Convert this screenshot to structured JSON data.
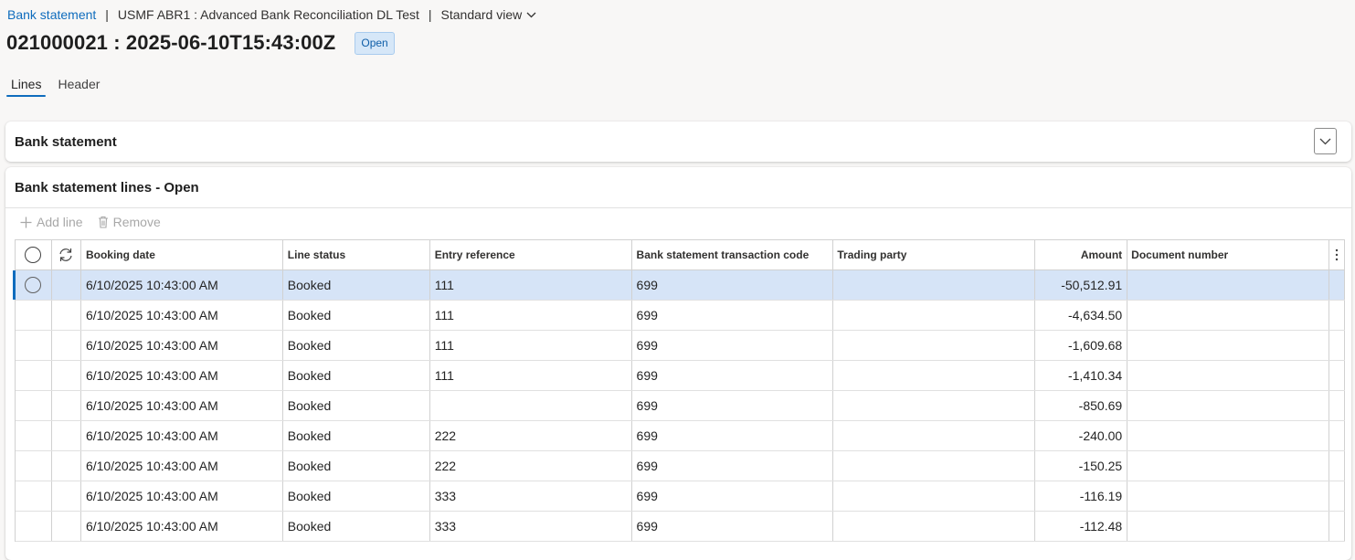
{
  "breadcrumb": {
    "link": "Bank statement",
    "company_context": "USMF ABR1 : Advanced Bank Reconciliation DL Test",
    "view": "Standard view"
  },
  "page": {
    "title": "021000021 : 2025-06-10T15:43:00Z",
    "status": "Open"
  },
  "tabs": [
    {
      "label": "Lines",
      "active": true
    },
    {
      "label": "Header",
      "active": false
    }
  ],
  "bank_statement_section": {
    "title": "Bank statement"
  },
  "lines_section": {
    "title": "Bank statement lines - Open",
    "toolbar": {
      "add_line": "Add line",
      "remove": "Remove"
    },
    "columns": {
      "booking_date": "Booking date",
      "line_status": "Line status",
      "entry_reference": "Entry reference",
      "transaction_code": "Bank statement transaction code",
      "trading_party": "Trading party",
      "amount": "Amount",
      "document_number": "Document number"
    },
    "rows": [
      {
        "booking_date": "6/10/2025 10:43:00 AM",
        "line_status": "Booked",
        "entry_reference": "111",
        "transaction_code": "699",
        "trading_party": "",
        "amount": "-50,512.91",
        "document_number": "",
        "selected": true
      },
      {
        "booking_date": "6/10/2025 10:43:00 AM",
        "line_status": "Booked",
        "entry_reference": "111",
        "transaction_code": "699",
        "trading_party": "",
        "amount": "-4,634.50",
        "document_number": ""
      },
      {
        "booking_date": "6/10/2025 10:43:00 AM",
        "line_status": "Booked",
        "entry_reference": "111",
        "transaction_code": "699",
        "trading_party": "",
        "amount": "-1,609.68",
        "document_number": ""
      },
      {
        "booking_date": "6/10/2025 10:43:00 AM",
        "line_status": "Booked",
        "entry_reference": "111",
        "transaction_code": "699",
        "trading_party": "",
        "amount": "-1,410.34",
        "document_number": ""
      },
      {
        "booking_date": "6/10/2025 10:43:00 AM",
        "line_status": "Booked",
        "entry_reference": "",
        "transaction_code": "699",
        "trading_party": "",
        "amount": "-850.69",
        "document_number": ""
      },
      {
        "booking_date": "6/10/2025 10:43:00 AM",
        "line_status": "Booked",
        "entry_reference": "222",
        "transaction_code": "699",
        "trading_party": "",
        "amount": "-240.00",
        "document_number": ""
      },
      {
        "booking_date": "6/10/2025 10:43:00 AM",
        "line_status": "Booked",
        "entry_reference": "222",
        "transaction_code": "699",
        "trading_party": "",
        "amount": "-150.25",
        "document_number": ""
      },
      {
        "booking_date": "6/10/2025 10:43:00 AM",
        "line_status": "Booked",
        "entry_reference": "333",
        "transaction_code": "699",
        "trading_party": "",
        "amount": "-116.19",
        "document_number": ""
      },
      {
        "booking_date": "6/10/2025 10:43:00 AM",
        "line_status": "Booked",
        "entry_reference": "333",
        "transaction_code": "699",
        "trading_party": "",
        "amount": "-112.48",
        "document_number": ""
      }
    ]
  },
  "colors": {
    "accent": "#0f6cbd",
    "selected_row": "#d6e4f7",
    "badge_bg": "#d6e7f8"
  }
}
